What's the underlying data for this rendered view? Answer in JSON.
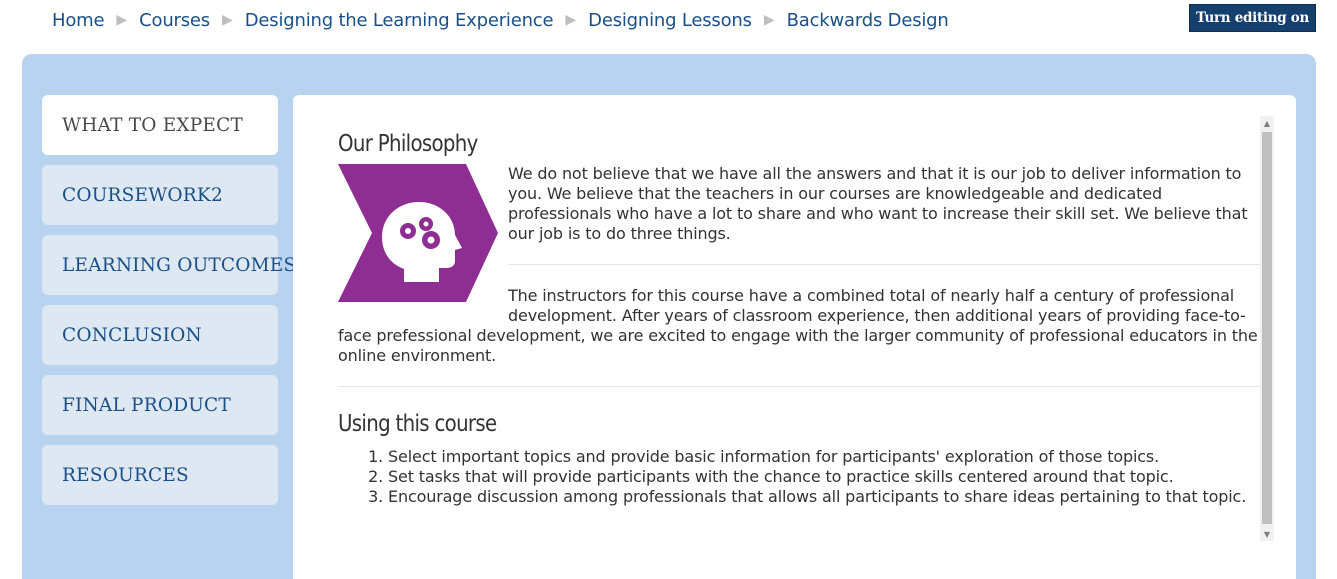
{
  "breadcrumb": {
    "items": [
      "Home",
      "Courses",
      "Designing the Learning Experience",
      "Designing Lessons",
      "Backwards Design"
    ],
    "separator": "▶"
  },
  "header": {
    "edit_button": "Turn editing on"
  },
  "nav": {
    "items": [
      {
        "label": "WHAT TO EXPECT",
        "active": true
      },
      {
        "label": "COURSEWORK2",
        "active": false
      },
      {
        "label": "LEARNING OUTCOMES",
        "active": false
      },
      {
        "label": "CONCLUSION",
        "active": false
      },
      {
        "label": "FINAL PRODUCT",
        "active": false
      },
      {
        "label": "RESOURCES",
        "active": false
      }
    ]
  },
  "main": {
    "section1": {
      "title": "Our Philosophy",
      "paragraph1": "We do not believe that we have all the answers and that it is our job to deliver information to you. We believe that the teachers in our courses are knowledgeable and dedicated professionals who have a lot to share and who want to increase their skill set. We believe that our job is to do three things.",
      "paragraph2": "The instructors for this course have a combined total of nearly half a century of professional development. After years of classroom experience, then additional years of providing face-to-face prefessional development, we are excited to engage with the larger community of professional educators in the online environment."
    },
    "section2": {
      "title": "Using this course",
      "list": [
        "Select important topics and provide basic information for participants' exploration of those topics.",
        "Set tasks that will provide participants with the chance to practice skills centered around that topic.",
        "Encourage discussion among professionals that allows all participants to share ideas pertaining to that topic."
      ]
    }
  },
  "colors": {
    "accent": "#1b4f88",
    "panel": "#b7d3f0",
    "logo": "#8e2e92",
    "button": "#153f6d"
  },
  "icons": {
    "logo": "head-gears-icon",
    "scroll_up": "arrow-up-icon",
    "scroll_down": "arrow-down-icon"
  }
}
